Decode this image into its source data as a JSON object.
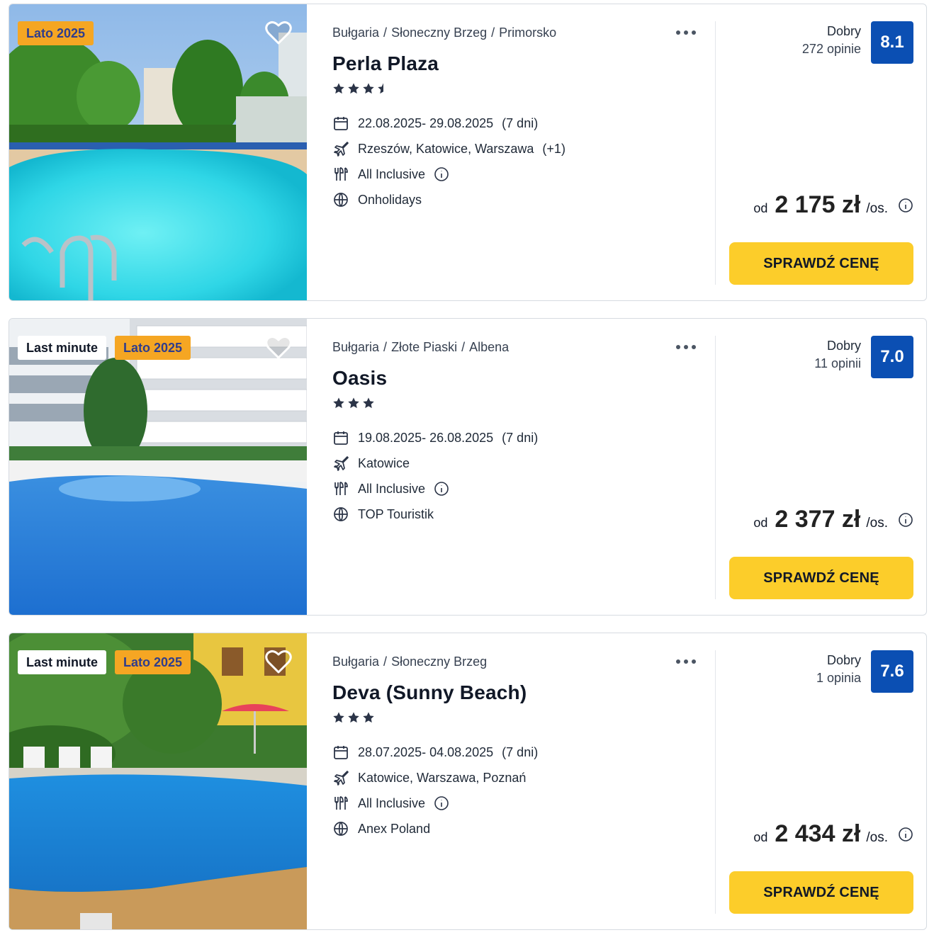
{
  "colors": {
    "score_bg": "#0b4fb3",
    "cta_bg": "#fccd2a",
    "lato_badge_bg": "#f5a623",
    "lato_badge_text": "#2f3d8c"
  },
  "icons": {
    "heart": "heart-outline-icon",
    "more": "more-dots-icon",
    "date": "calendar-icon",
    "departure": "plane-icon",
    "board": "cutlery-icon",
    "operator": "globe-icon",
    "info": "info-icon",
    "star": "star-icon"
  },
  "offers": [
    {
      "badges": {
        "last_minute": "",
        "season": "Lato 2025"
      },
      "breadcrumb": [
        "Bułgaria",
        "Słoneczny Brzeg",
        "Primorsko"
      ],
      "name": "Perla Plaza",
      "stars": 3.5,
      "dates": "22.08.2025- 29.08.2025",
      "duration": "(7 dni)",
      "departure": "Rzeszów, Katowice, Warszawa",
      "departure_extra": "(+1)",
      "board": "All Inclusive",
      "operator": "Onholidays",
      "rating_word": "Dobry",
      "review_count": "272 opinie",
      "score": "8.1",
      "price_prefix": "od",
      "price": "2 175 zł",
      "price_suffix": "/os.",
      "cta": "SPRAWDŹ CENĘ"
    },
    {
      "badges": {
        "last_minute": "Last minute",
        "season": "Lato 2025"
      },
      "breadcrumb": [
        "Bułgaria",
        "Złote Piaski",
        "Albena"
      ],
      "name": "Oasis",
      "stars": 3,
      "dates": "19.08.2025- 26.08.2025",
      "duration": "(7 dni)",
      "departure": "Katowice",
      "departure_extra": "",
      "board": "All Inclusive",
      "operator": "TOP Touristik",
      "rating_word": "Dobry",
      "review_count": "11 opinii",
      "score": "7.0",
      "price_prefix": "od",
      "price": "2 377 zł",
      "price_suffix": "/os.",
      "cta": "SPRAWDŹ CENĘ"
    },
    {
      "badges": {
        "last_minute": "Last minute",
        "season": "Lato 2025"
      },
      "breadcrumb": [
        "Bułgaria",
        "Słoneczny Brzeg"
      ],
      "name": "Deva (Sunny Beach)",
      "stars": 3,
      "dates": "28.07.2025- 04.08.2025",
      "duration": "(7 dni)",
      "departure": "Katowice, Warszawa, Poznań",
      "departure_extra": "",
      "board": "All Inclusive",
      "operator": "Anex Poland",
      "rating_word": "Dobry",
      "review_count": "1 opinia",
      "score": "7.6",
      "price_prefix": "od",
      "price": "2 434 zł",
      "price_suffix": "/os.",
      "cta": "SPRAWDŹ CENĘ"
    }
  ]
}
